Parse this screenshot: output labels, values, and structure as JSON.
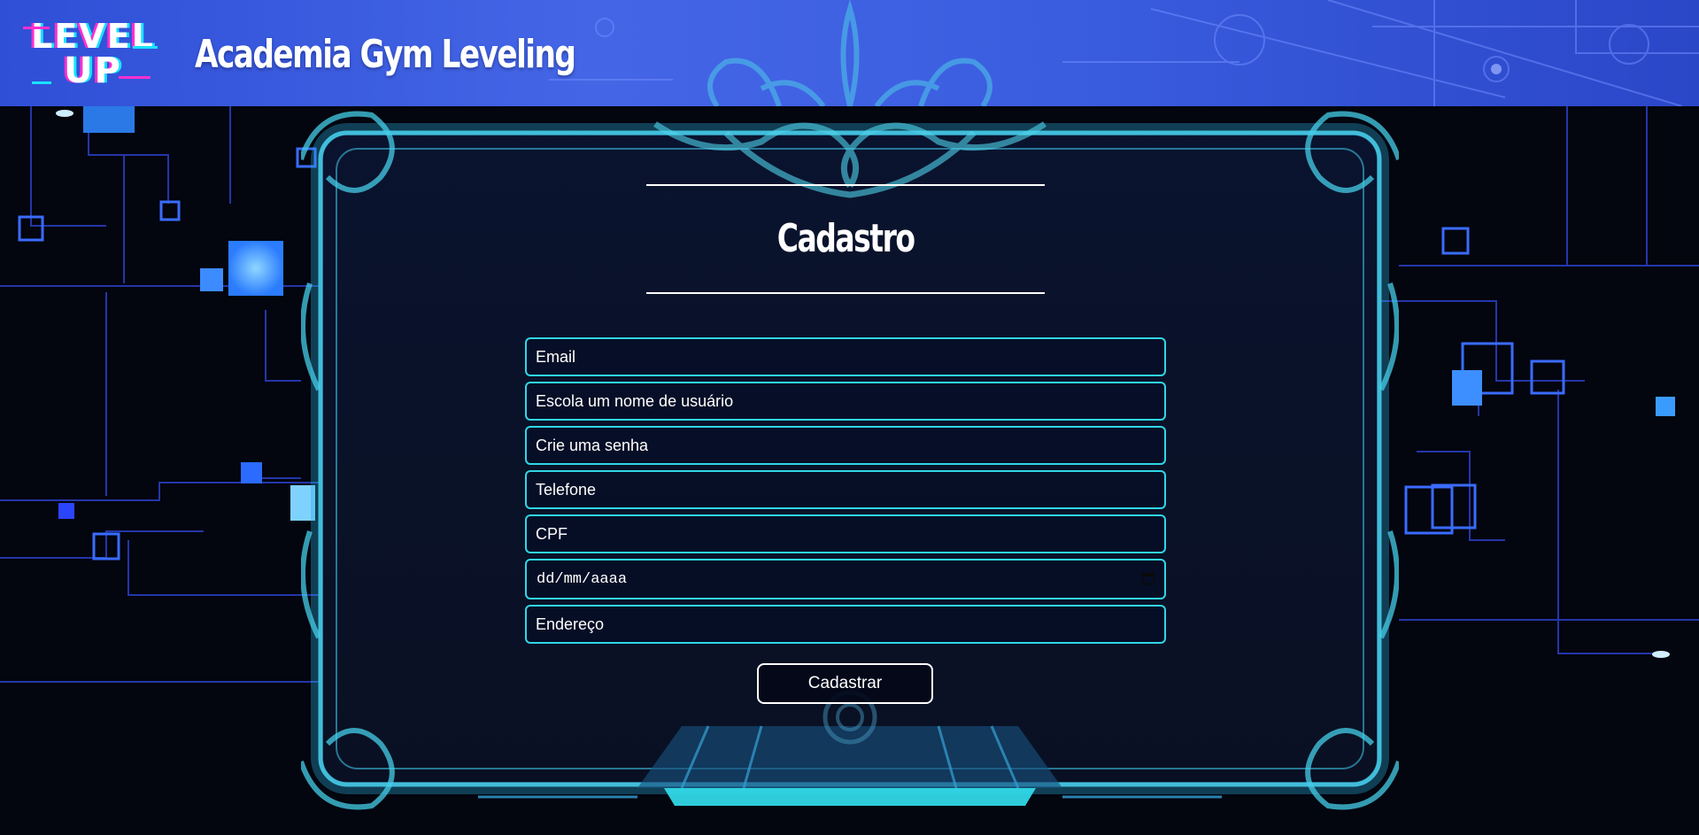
{
  "header": {
    "logo_line1": "LEVEL",
    "logo_line2": "UP",
    "title": "Academia Gym Leveling"
  },
  "form": {
    "heading": "Cadastro",
    "fields": {
      "email_placeholder": "Email",
      "username_placeholder": "Escola um nome de usuário",
      "password_placeholder": "Crie uma senha",
      "phone_placeholder": "Telefone",
      "cpf_placeholder": "CPF",
      "date_placeholder": "dd/mm/aaaa",
      "address_placeholder": "Endereço"
    },
    "submit_label": "Cadastrar"
  },
  "icons": {
    "calendar": "calendar-icon"
  },
  "colors": {
    "header_blue": "#3b5ee0",
    "field_border": "#2fd6e6",
    "frame_glow": "#38c9e8",
    "background": "#03050f"
  }
}
